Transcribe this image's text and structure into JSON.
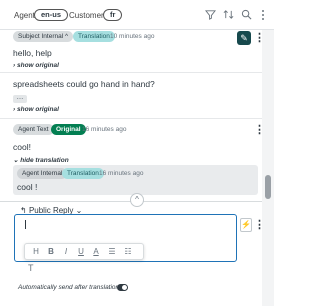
{
  "header": {
    "agent_label": "Agent:",
    "agent_lang": "en-us",
    "customer_label": "Customer:",
    "customer_lang": "fr",
    "icons": [
      "filter-icon",
      "sort-icon",
      "search-icon",
      "kebab-menu-icon"
    ]
  },
  "messages": [
    {
      "badge": "Subject Internal",
      "badge_chevron": "^",
      "translation_badge": "Translation",
      "timestamp": "10 minutes ago",
      "body": "hello, help",
      "show_original": "show original"
    },
    {
      "body_line1": "spreadsheets could go hand in hand?",
      "ellipsis": "...",
      "show_original": "show original"
    },
    {
      "badge": "Agent Text",
      "badge2": "Original",
      "timestamp": "16 minutes ago",
      "body": "cool!",
      "hide_translation": "hide translation",
      "nested": {
        "badge": "Agent Internal",
        "translation_badge": "Translation",
        "timestamp": "16 minutes ago",
        "body": "cool !"
      }
    }
  ],
  "composer": {
    "reply_type": "Public Reply",
    "toolbar": [
      "H",
      "B",
      "I",
      "U",
      "A",
      "list",
      "numbered-list"
    ],
    "t_label": "T",
    "auto_send_text": "Automatically send after translation",
    "auto_send_on": true
  },
  "colors": {
    "accent": "#1f73b7",
    "teal": "#a6dfe0",
    "green": "#037f52"
  }
}
